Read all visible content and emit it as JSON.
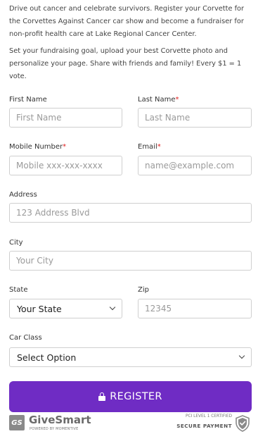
{
  "intro": {
    "p1": "Drive out cancer and celebrate survivors. Register your Corvette for the Corvettes Against Cancer car show and become a fundraiser for non-profit health care at Lake Regional Cancer Center.",
    "p2": "Set your fundraising goal, upload your best Corvette photo and personalize your page. Share with friends and family! Every $1 = 1 vote."
  },
  "form": {
    "first_name": {
      "label": "First Name",
      "placeholder": "First Name"
    },
    "last_name": {
      "label": "Last Name",
      "required_mark": "*",
      "placeholder": "Last Name"
    },
    "mobile": {
      "label": "Mobile Number",
      "required_mark": "*",
      "placeholder": "Mobile xxx-xxx-xxxx"
    },
    "email": {
      "label": "Email",
      "required_mark": "*",
      "placeholder": "name@example.com"
    },
    "address": {
      "label": "Address",
      "placeholder": "123 Address Blvd"
    },
    "city": {
      "label": "City",
      "placeholder": "Your City"
    },
    "state": {
      "label": "State",
      "selected": "Your State"
    },
    "zip": {
      "label": "Zip",
      "placeholder": "12345"
    },
    "car_class": {
      "label": "Car Class",
      "selected": "Select Option"
    }
  },
  "register": {
    "label": "REGISTER",
    "icon": "lock-icon",
    "color": "#6f2cc4"
  },
  "footer": {
    "badge": "GS",
    "brand": "GiveSmart",
    "brand_sub": "POWERED BY MOMENTIVE",
    "pci": "PCI LEVEL 1 CERTIFIED",
    "secure": "SECURE PAYMENT",
    "shield_icon": "shield-check-icon"
  }
}
